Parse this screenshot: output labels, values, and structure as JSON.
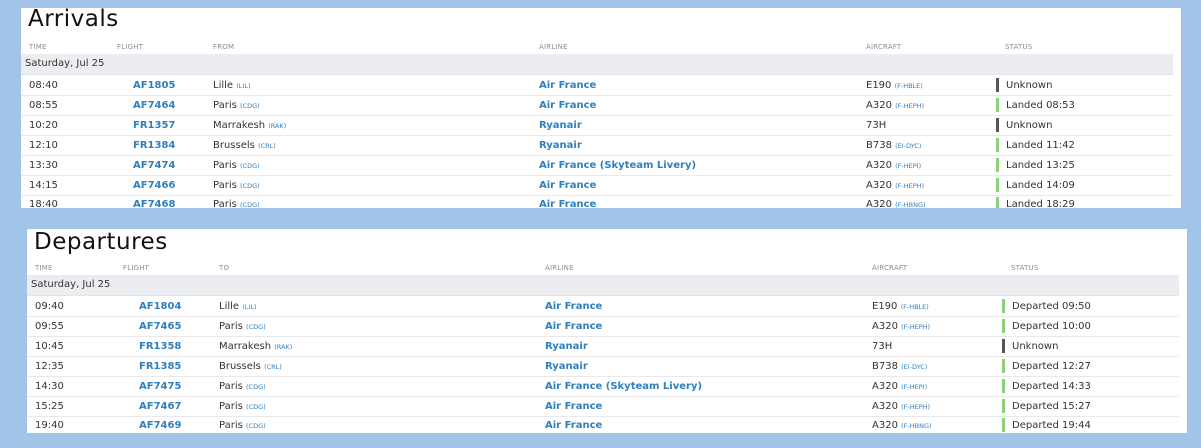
{
  "arrivals": {
    "title": "Arrivals",
    "headers": {
      "time": "TIME",
      "flight": "FLIGHT",
      "from": "FROM",
      "airline": "AIRLINE",
      "aircraft": "AIRCRAFT",
      "status": "STATUS"
    },
    "date": "Saturday, Jul 25",
    "rows": [
      {
        "time": "08:40",
        "flight": "AF1805",
        "city": "Lille",
        "code": "(LIL)",
        "airline": "Air France",
        "aircraft": "E190",
        "reg": "(F-HBLE)",
        "status": "Unknown",
        "status_color": "#555555"
      },
      {
        "time": "08:55",
        "flight": "AF7464",
        "city": "Paris",
        "code": "(CDG)",
        "airline": "Air France",
        "aircraft": "A320",
        "reg": "(F-HEPH)",
        "status": "Landed 08:53",
        "status_color": "#8fd17a"
      },
      {
        "time": "10:20",
        "flight": "FR1357",
        "city": "Marrakesh",
        "code": "(RAK)",
        "airline": "Ryanair",
        "aircraft": "73H",
        "reg": "",
        "status": "Unknown",
        "status_color": "#555555"
      },
      {
        "time": "12:10",
        "flight": "FR1384",
        "city": "Brussels",
        "code": "(CRL)",
        "airline": "Ryanair",
        "aircraft": "B738",
        "reg": "(EI-DYC)",
        "status": "Landed 11:42",
        "status_color": "#8fd17a"
      },
      {
        "time": "13:30",
        "flight": "AF7474",
        "city": "Paris",
        "code": "(CDG)",
        "airline": "Air France (Skyteam Livery)",
        "aircraft": "A320",
        "reg": "(F-HEPI)",
        "status": "Landed 13:25",
        "status_color": "#8fd17a"
      },
      {
        "time": "14:15",
        "flight": "AF7466",
        "city": "Paris",
        "code": "(CDG)",
        "airline": "Air France",
        "aircraft": "A320",
        "reg": "(F-HEPH)",
        "status": "Landed 14:09",
        "status_color": "#8fd17a"
      },
      {
        "time": "18:40",
        "flight": "AF7468",
        "city": "Paris",
        "code": "(CDG)",
        "airline": "Air France",
        "aircraft": "A320",
        "reg": "(F-HBNG)",
        "status": "Landed 18:29",
        "status_color": "#8fd17a"
      }
    ]
  },
  "departures": {
    "title": "Departures",
    "headers": {
      "time": "TIME",
      "flight": "FLIGHT",
      "to": "TO",
      "airline": "AIRLINE",
      "aircraft": "AIRCRAFT",
      "status": "STATUS"
    },
    "date": "Saturday, Jul 25",
    "rows": [
      {
        "time": "09:40",
        "flight": "AF1804",
        "city": "Lille",
        "code": "(LIL)",
        "airline": "Air France",
        "aircraft": "E190",
        "reg": "(F-HBLE)",
        "status": "Departed 09:50",
        "status_color": "#8fd17a"
      },
      {
        "time": "09:55",
        "flight": "AF7465",
        "city": "Paris",
        "code": "(CDG)",
        "airline": "Air France",
        "aircraft": "A320",
        "reg": "(F-HEPH)",
        "status": "Departed 10:00",
        "status_color": "#8fd17a"
      },
      {
        "time": "10:45",
        "flight": "FR1358",
        "city": "Marrakesh",
        "code": "(RAK)",
        "airline": "Ryanair",
        "aircraft": "73H",
        "reg": "",
        "status": "Unknown",
        "status_color": "#555555"
      },
      {
        "time": "12:35",
        "flight": "FR1385",
        "city": "Brussels",
        "code": "(CRL)",
        "airline": "Ryanair",
        "aircraft": "B738",
        "reg": "(EI-DYC)",
        "status": "Departed 12:27",
        "status_color": "#8fd17a"
      },
      {
        "time": "14:30",
        "flight": "AF7475",
        "city": "Paris",
        "code": "(CDG)",
        "airline": "Air France (Skyteam Livery)",
        "aircraft": "A320",
        "reg": "(F-HEPI)",
        "status": "Departed 14:33",
        "status_color": "#8fd17a"
      },
      {
        "time": "15:25",
        "flight": "AF7467",
        "city": "Paris",
        "code": "(CDG)",
        "airline": "Air France",
        "aircraft": "A320",
        "reg": "(F-HEPH)",
        "status": "Departed 15:27",
        "status_color": "#8fd17a"
      },
      {
        "time": "19:40",
        "flight": "AF7469",
        "city": "Paris",
        "code": "(CDG)",
        "airline": "Air France",
        "aircraft": "A320",
        "reg": "(F-HBNG)",
        "status": "Departed 19:44",
        "status_color": "#8fd17a"
      }
    ]
  }
}
